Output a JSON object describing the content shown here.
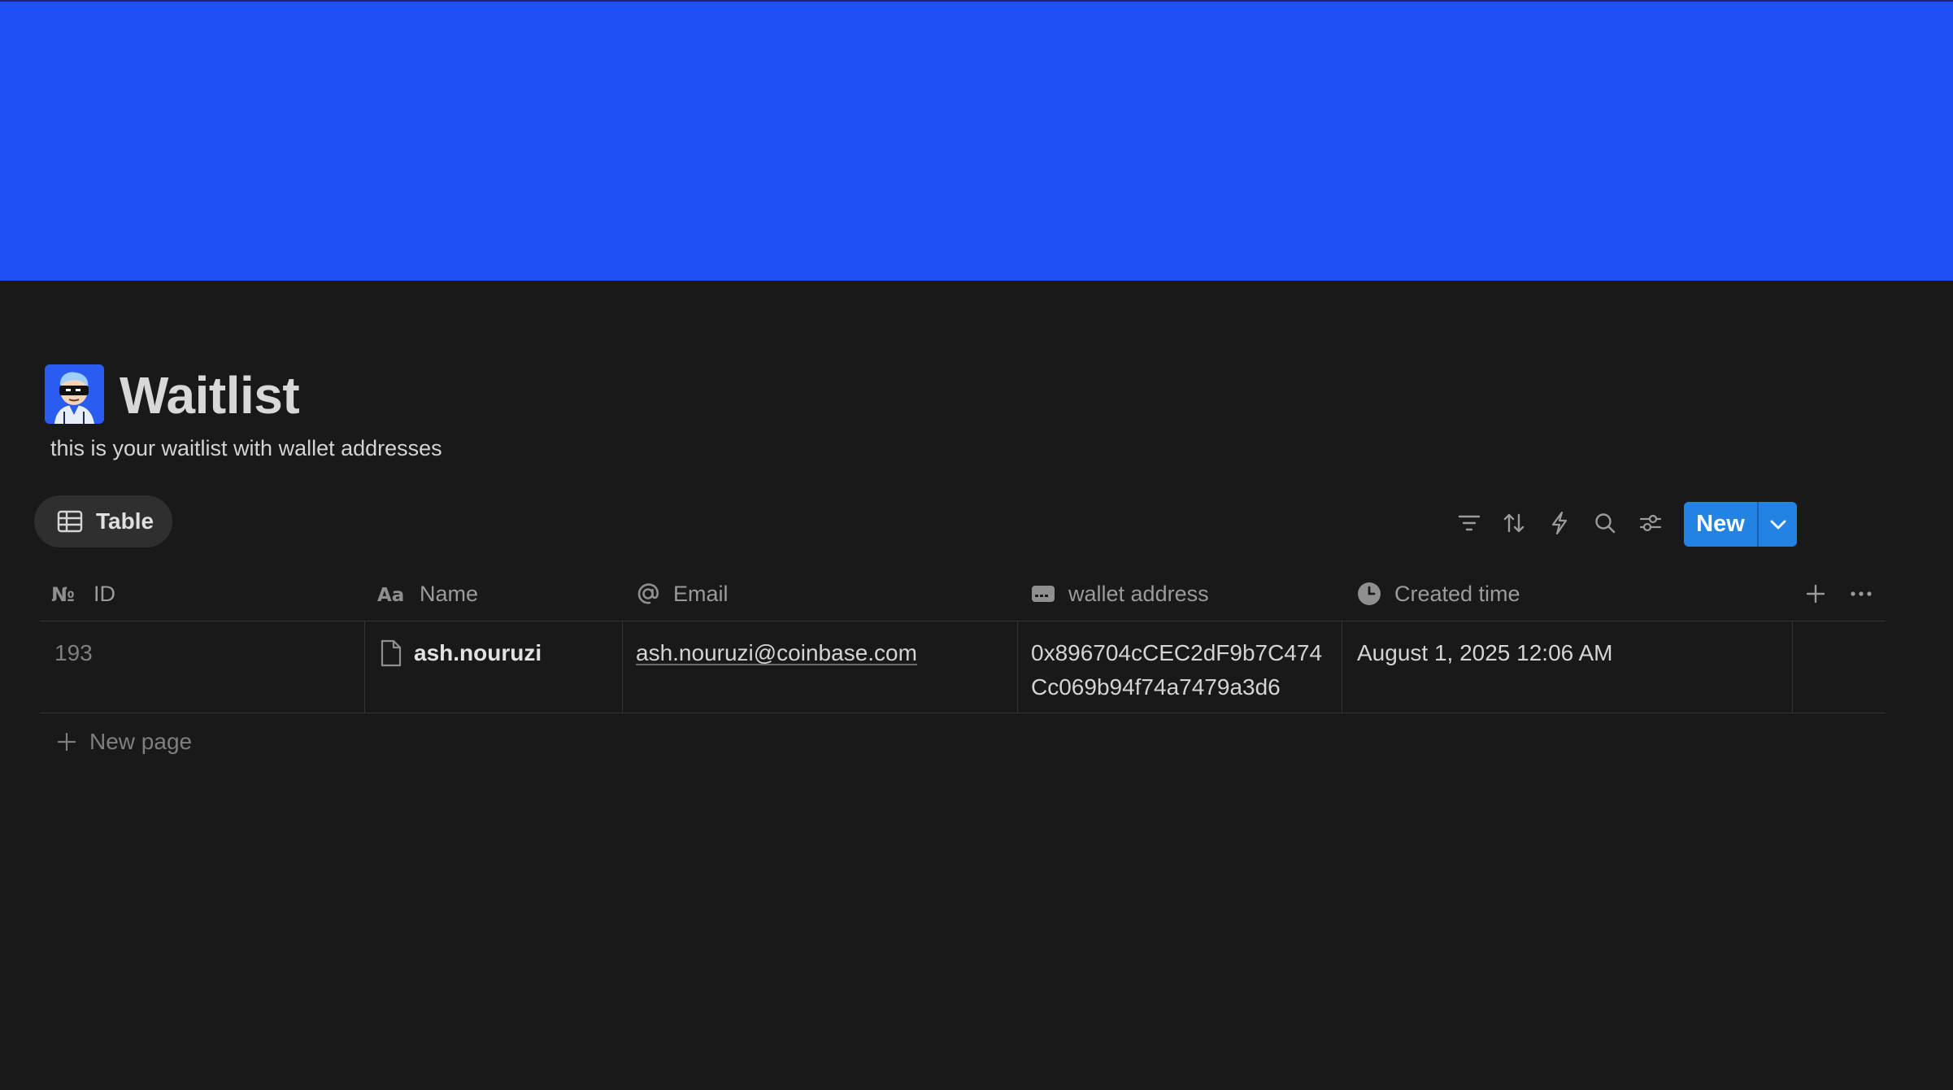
{
  "page": {
    "title": "Waitlist",
    "description": "this is your waitlist with wallet addresses",
    "cover_color": "#1f50f6",
    "icon": "avatar-icon"
  },
  "view": {
    "tab_label": "Table",
    "tab_icon": "table-icon"
  },
  "toolbar": {
    "icons": [
      "filter-icon",
      "sort-icon",
      "automation-icon",
      "search-icon",
      "settings-icon"
    ],
    "new_label": "New",
    "new_color": "#2383e2"
  },
  "table": {
    "columns": [
      {
        "label": "ID",
        "icon": "number-icon"
      },
      {
        "label": "Name",
        "icon": "text-icon"
      },
      {
        "label": "Email",
        "icon": "at-icon"
      },
      {
        "label": "wallet address",
        "icon": "card-icon"
      },
      {
        "label": "Created time",
        "icon": "clock-icon"
      }
    ],
    "rows": [
      {
        "id": "193",
        "name": "ash.nouruzi",
        "email": "ash.nouruzi@coinbase.com",
        "wallet": "0x896704cCEC2dF9b7C474Cc069b94f74a7479a3d6",
        "created": "August 1, 2025 12:06 AM"
      }
    ],
    "new_page_label": "New page"
  }
}
